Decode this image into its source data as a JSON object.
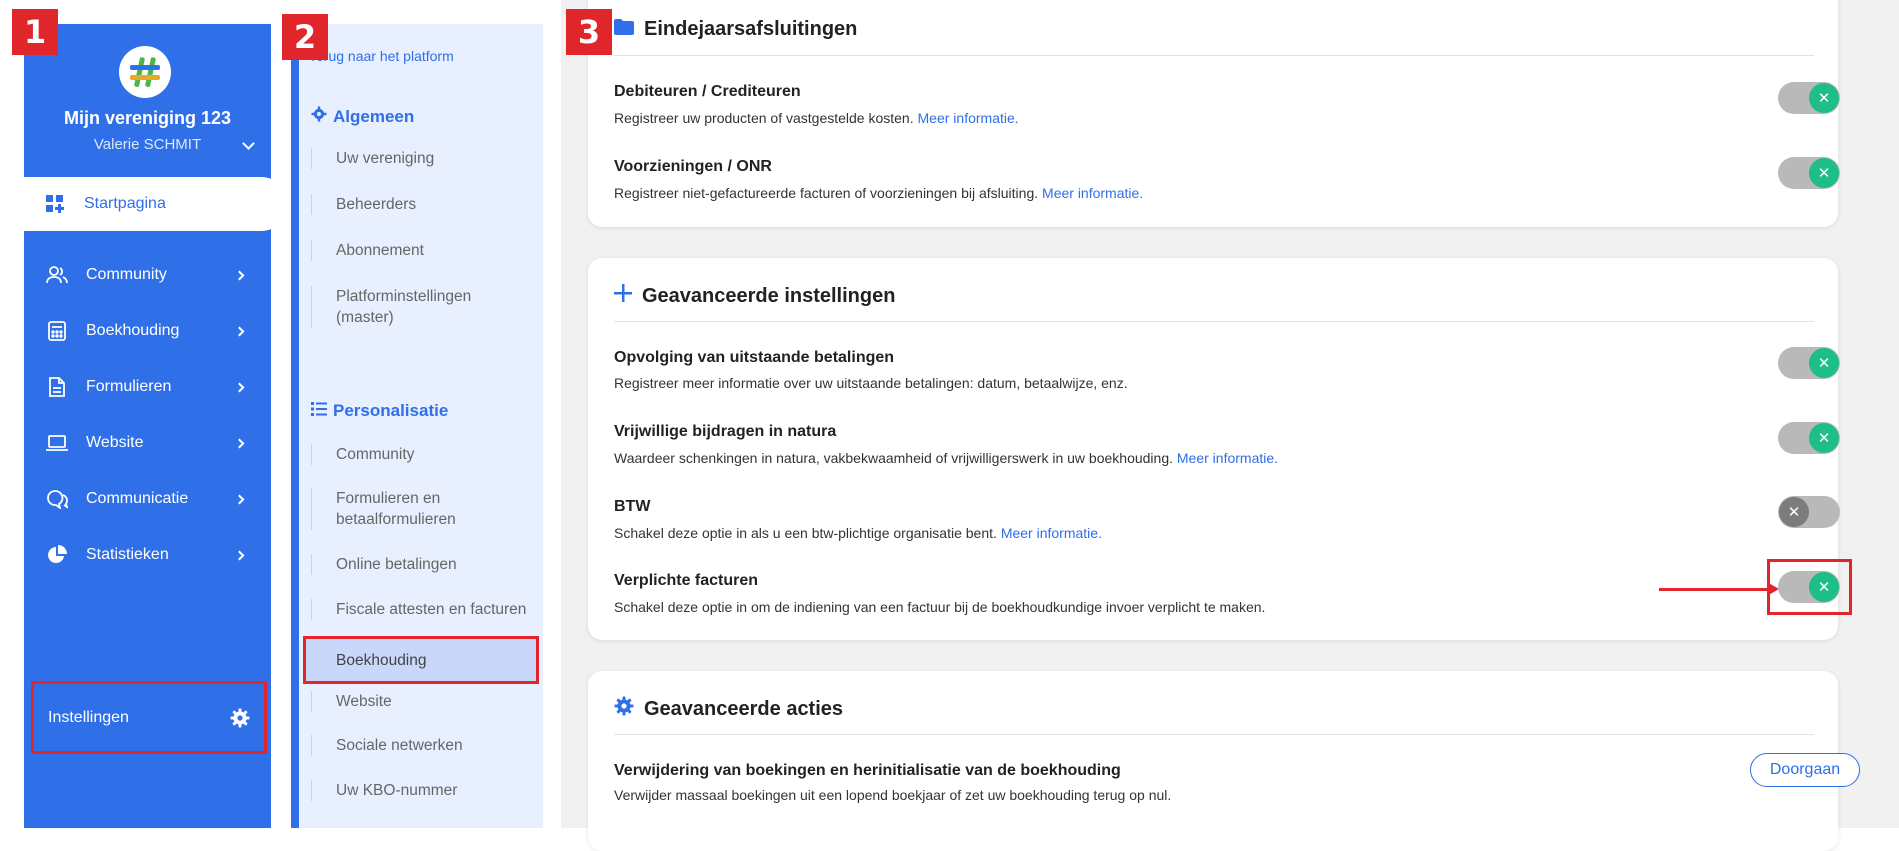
{
  "badges": [
    "1",
    "2",
    "3"
  ],
  "sidebar": {
    "org_name": "Mijn vereniging 123",
    "user_name": "Valerie SCHMIT",
    "items": [
      {
        "label": "Startpagina",
        "icon": "dashboard-icon"
      },
      {
        "label": "Community",
        "icon": "users-icon"
      },
      {
        "label": "Boekhouding",
        "icon": "calculator-icon"
      },
      {
        "label": "Formulieren",
        "icon": "document-icon"
      },
      {
        "label": "Website",
        "icon": "laptop-icon"
      },
      {
        "label": "Communicatie",
        "icon": "chat-icon"
      },
      {
        "label": "Statistieken",
        "icon": "piechart-icon"
      }
    ],
    "settings_label": "Instellingen",
    "accent": "#2f6fe8",
    "highlight": "#e0262b"
  },
  "panel2": {
    "back_label": "Terug naar het platform",
    "section1": "Algemeen",
    "section1_items": [
      "Uw vereniging",
      "Beheerders",
      "Abonnement",
      "Platforminstellingen (master)"
    ],
    "section2": "Personalisatie",
    "section2_items": [
      "Community",
      "Formulieren en betaalformulieren",
      "Online betalingen",
      "Fiscale attesten en facturen",
      "Boekhouding",
      "Website",
      "Sociale netwerken",
      "Uw KBO-nummer"
    ]
  },
  "main": {
    "card1": {
      "title": "Eindejaarsafsluitingen",
      "rows": [
        {
          "title": "Debiteuren / Crediteuren",
          "desc": "Registreer uw producten of vastgestelde kosten.",
          "link": "Meer informatie.",
          "state": "on"
        },
        {
          "title": "Voorzieningen / ONR",
          "desc": "Registreer niet-gefactureerde facturen of voorzieningen bij afsluiting.",
          "link": "Meer informatie.",
          "state": "on"
        }
      ]
    },
    "card2": {
      "title": "Geavanceerde instellingen",
      "rows": [
        {
          "title": "Opvolging van uitstaande betalingen",
          "desc": "Registreer meer informatie over uw uitstaande betalingen: datum, betaalwijze, enz.",
          "link": "",
          "state": "on"
        },
        {
          "title": "Vrijwillige bijdragen in natura",
          "desc": "Waardeer schenkingen in natura, vakbekwaamheid of vrijwilligerswerk in uw boekhouding.",
          "link": "Meer informatie.",
          "state": "on"
        },
        {
          "title": "BTW",
          "desc": "Schakel deze optie in als u een btw-plichtige organisatie bent.",
          "link": "Meer informatie.",
          "state": "off"
        },
        {
          "title": "Verplichte facturen",
          "desc": "Schakel deze optie in om de indiening van een factuur bij de boekhoudkundige invoer verplicht te maken.",
          "link": "",
          "state": "on"
        }
      ]
    },
    "card3": {
      "title": "Geavanceerde acties",
      "row_title": "Verwijdering van boekingen en herinitialisatie van de boekhouding",
      "row_desc": "Verwijder massaal boekingen uit een lopend boekjaar of zet uw boekhouding terug op nul.",
      "button": "Doorgaan"
    },
    "toggle_knob_glyph": "✕"
  }
}
